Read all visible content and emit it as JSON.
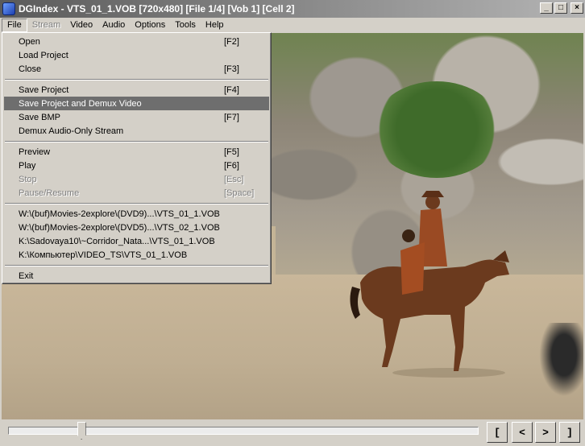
{
  "window": {
    "title": "DGIndex - VTS_01_1.VOB [720x480] [File 1/4] [Vob 1] [Cell 2]",
    "buttons": [
      "_",
      "□",
      "×"
    ]
  },
  "menubar": {
    "items": [
      {
        "label": "File",
        "state": "active"
      },
      {
        "label": "Stream",
        "state": "disabled"
      },
      {
        "label": "Video",
        "state": "normal"
      },
      {
        "label": "Audio",
        "state": "normal"
      },
      {
        "label": "Options",
        "state": "normal"
      },
      {
        "label": "Tools",
        "state": "normal"
      },
      {
        "label": "Help",
        "state": "normal"
      }
    ]
  },
  "file_menu": {
    "open": {
      "label": "Open",
      "shortcut": "[F2]"
    },
    "load_project": {
      "label": "Load Project"
    },
    "close": {
      "label": "Close",
      "shortcut": "[F3]"
    },
    "save_project": {
      "label": "Save Project",
      "shortcut": "[F4]"
    },
    "save_demux": {
      "label": "Save Project and Demux Video"
    },
    "save_bmp": {
      "label": "Save BMP",
      "shortcut": "[F7]"
    },
    "demux_audio": {
      "label": "Demux Audio-Only Stream"
    },
    "preview": {
      "label": "Preview",
      "shortcut": "[F5]"
    },
    "play": {
      "label": "Play",
      "shortcut": "[F6]"
    },
    "stop": {
      "label": "Stop",
      "shortcut": "[Esc]"
    },
    "pause": {
      "label": "Pause/Resume",
      "shortcut": "[Space]"
    },
    "recent": [
      "W:\\(buf)Movies-2explore\\(DVD9)...\\VTS_01_1.VOB",
      "W:\\(buf)Movies-2explore\\(DVD5)...\\VTS_02_1.VOB",
      "K:\\Sadovaya10\\~Corridor_Nata...\\VTS_01_1.VOB",
      "K:\\Компьютер\\VIDEO_TS\\VTS_01_1.VOB"
    ],
    "exit": {
      "label": "Exit"
    }
  },
  "controls": {
    "position_fraction": 0.156,
    "buttons": [
      "[",
      "<",
      ">",
      "]"
    ]
  },
  "colors": {
    "menu_bg": "#d4d0c8",
    "highlight": "#6e6e6e",
    "title_gradient_start": "#5a5a5a"
  }
}
